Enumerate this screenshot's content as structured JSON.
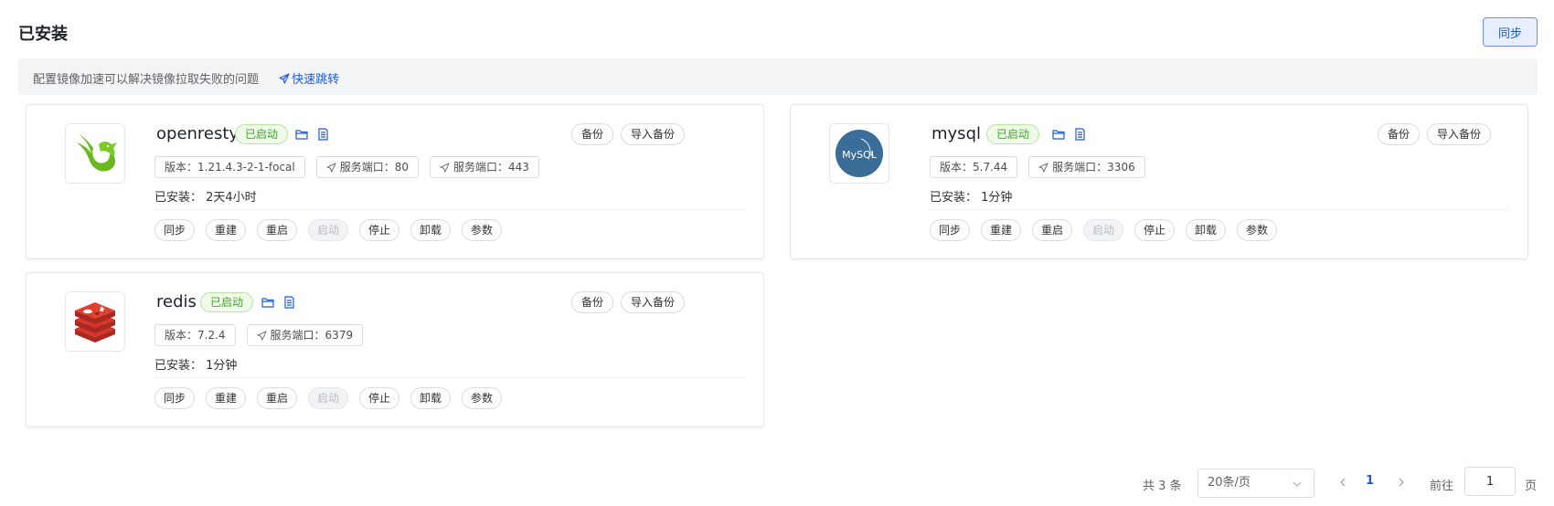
{
  "header": {
    "title": "已安装",
    "sync_label": "同步"
  },
  "notice": {
    "text": "配置镜像加速可以解决镜像拉取失败的问题",
    "link": "快速跳转"
  },
  "apps": [
    {
      "name": "openresty",
      "status": "已启动",
      "logo": "openresty-bird-logo",
      "version": "版本：1.21.4.3-2-1-focal",
      "ports": [
        "服务端口：80",
        "服务端口：443"
      ],
      "installed": "已安装：  2天4小时",
      "backup": "备份",
      "import_backup": "导入备份",
      "actions": [
        "同步",
        "重建",
        "重启",
        "启动",
        "停止",
        "卸载",
        "参数"
      ]
    },
    {
      "name": "mysql",
      "status": "已启动",
      "logo": "mysql-logo",
      "version": "版本：5.7.44",
      "ports": [
        "服务端口：3306"
      ],
      "installed": "已安装：  1分钟",
      "backup": "备份",
      "import_backup": "导入备份",
      "actions": [
        "同步",
        "重建",
        "重启",
        "启动",
        "停止",
        "卸载",
        "参数"
      ]
    },
    {
      "name": "redis",
      "status": "已启动",
      "logo": "redis-logo",
      "version": "版本：7.2.4",
      "ports": [
        "服务端口：6379"
      ],
      "installed": "已安装：  1分钟",
      "backup": "备份",
      "import_backup": "导入备份",
      "actions": [
        "同步",
        "重建",
        "重启",
        "启动",
        "停止",
        "卸载",
        "参数"
      ]
    }
  ],
  "mysql_logo_text": "MySQL",
  "pagination": {
    "total": "共 3 条",
    "page_size": "20条/页",
    "current": "1",
    "goto_label": "前往",
    "goto_value": "1",
    "page_unit": "页"
  },
  "colors": {
    "accent": "#1d5ad8",
    "success": "#3fa52a",
    "redis": "#d8352a",
    "mysql_bg": "#3a6e99",
    "openresty": "#6ab81f"
  }
}
